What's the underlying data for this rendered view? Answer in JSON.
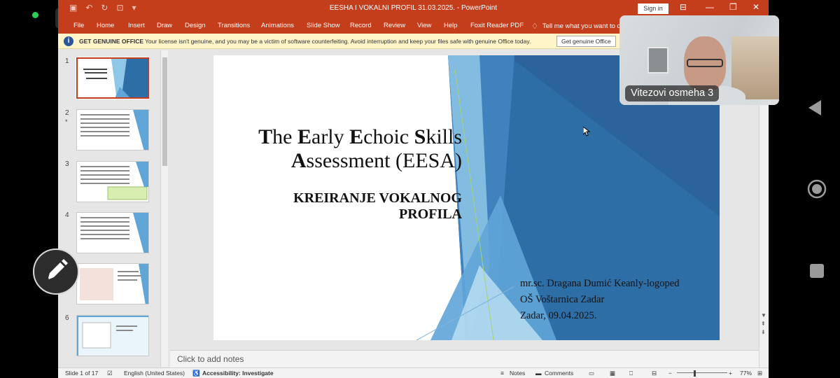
{
  "titlebar": {
    "title": "EESHA I VOKALNI PROFIL 31.03.2025.  -  PowerPoint",
    "signin": "Sign in"
  },
  "ribbon": {
    "tabs": [
      "File",
      "Home",
      "Insert",
      "Draw",
      "Design",
      "Transitions",
      "Animations",
      "Slide Show",
      "Record",
      "Review",
      "View",
      "Help",
      "Foxit Reader PDF"
    ],
    "tell_me": "Tell me what you want to d"
  },
  "infobar": {
    "title": "GET GENUINE OFFICE",
    "message": "Your license isn't genuine, and you may be a victim of software counterfeiting. Avoid interruption and keep your files safe with genuine Office today.",
    "button": "Get genuine Office"
  },
  "thumbnails": [
    {
      "num": "1",
      "star": ""
    },
    {
      "num": "2",
      "star": "*"
    },
    {
      "num": "3",
      "star": ""
    },
    {
      "num": "4",
      "star": ""
    },
    {
      "num": "5",
      "star": ""
    },
    {
      "num": "6",
      "star": ""
    }
  ],
  "slide": {
    "title_line1": {
      "T": "T",
      "he": "he ",
      "E1": "E",
      "arly": "arly ",
      "E2": "E",
      "choic": "choic ",
      "S": "S",
      "kills": "kills"
    },
    "title_line2": {
      "A": "A",
      "rest": "ssessment (EESA)"
    },
    "subtitle_line1": "KREIRANJE VOKALNOG",
    "subtitle_line2": "PROFILA",
    "info": [
      "mr.sc. Dragana Dumić Keanly-logoped",
      "OŠ Voštarnica Zadar",
      "Zadar, 09.04.2025."
    ]
  },
  "notes_placeholder": "Click to add notes",
  "statusbar": {
    "slide": "Slide 1 of 17",
    "language": "English (United States)",
    "accessibility": "Accessibility: Investigate",
    "notes": "Notes",
    "comments": "Comments",
    "zoom": "77%"
  },
  "video": {
    "participant": "Vitezovi osmeha 3"
  },
  "colors": {
    "ppt_accent": "#c43e1c",
    "slide_blue_dark": "#2e6ea6",
    "slide_blue_light": "#8fc7e8"
  }
}
